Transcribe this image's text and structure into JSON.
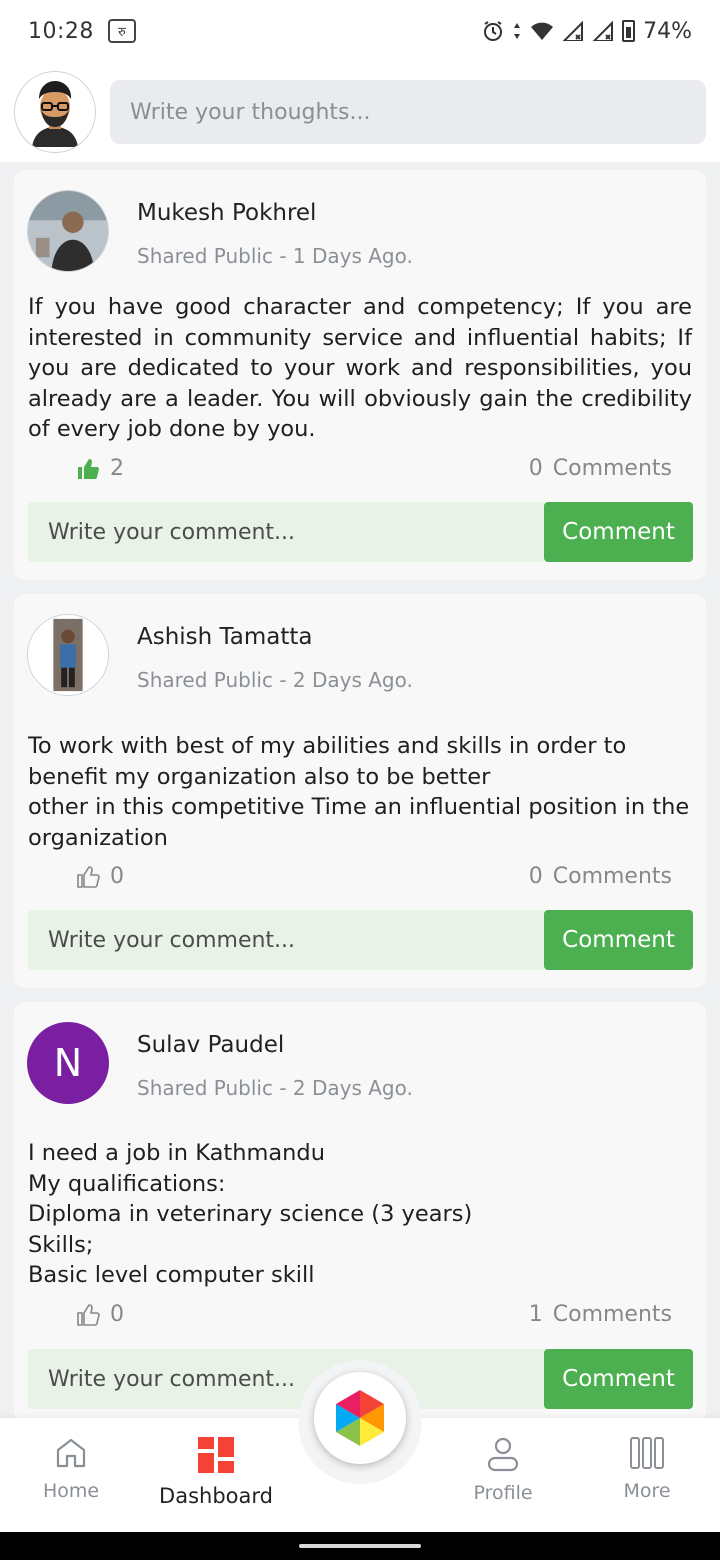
{
  "status_bar": {
    "time": "10:28",
    "rupee": "रु",
    "battery": "74%"
  },
  "composer": {
    "placeholder": "Write your thoughts..."
  },
  "posts": [
    {
      "author": "Mukesh Pokhrel",
      "meta": "Shared Public - 1 Days Ago.",
      "text": "If you have good character and competency; If you are interested in community service and influential habits; If you are dedicated to your work and responsibilities, you already are a leader. You will obviously gain the credibility of every job done by you.",
      "likes": "2",
      "liked": true,
      "comments_count": "0",
      "comments_label": "Comments",
      "comment_placeholder": "Write your comment...",
      "comment_button": "Comment"
    },
    {
      "author": "Ashish Tamatta",
      "meta": "Shared Public - 2 Days Ago.",
      "text": "To work with best of my abilities and skills in order to benefit my organization also to be better\nother in this competitive Time an influential position in the organization",
      "likes": "0",
      "liked": false,
      "comments_count": "0",
      "comments_label": "Comments",
      "comment_placeholder": "Write your comment...",
      "comment_button": "Comment"
    },
    {
      "author": "Sulav Paudel",
      "avatar_letter": "N",
      "meta": "Shared Public - 2 Days Ago.",
      "text": "I need a job in Kathmandu\nMy qualifications:\nDiploma in veterinary science (3 years)\nSkills;\nBasic level computer skill",
      "likes": "0",
      "liked": false,
      "comments_count": "1",
      "comments_label": "Comments",
      "comment_placeholder": "Write your comment...",
      "comment_button": "Comment"
    }
  ],
  "nav": {
    "home": "Home",
    "dashboard": "Dashboard",
    "profile": "Profile",
    "more": "More"
  },
  "colors": {
    "accent_green": "#4caf50",
    "dashboard_red": "#f44336",
    "letter_avatar": "#7b1fa2"
  }
}
